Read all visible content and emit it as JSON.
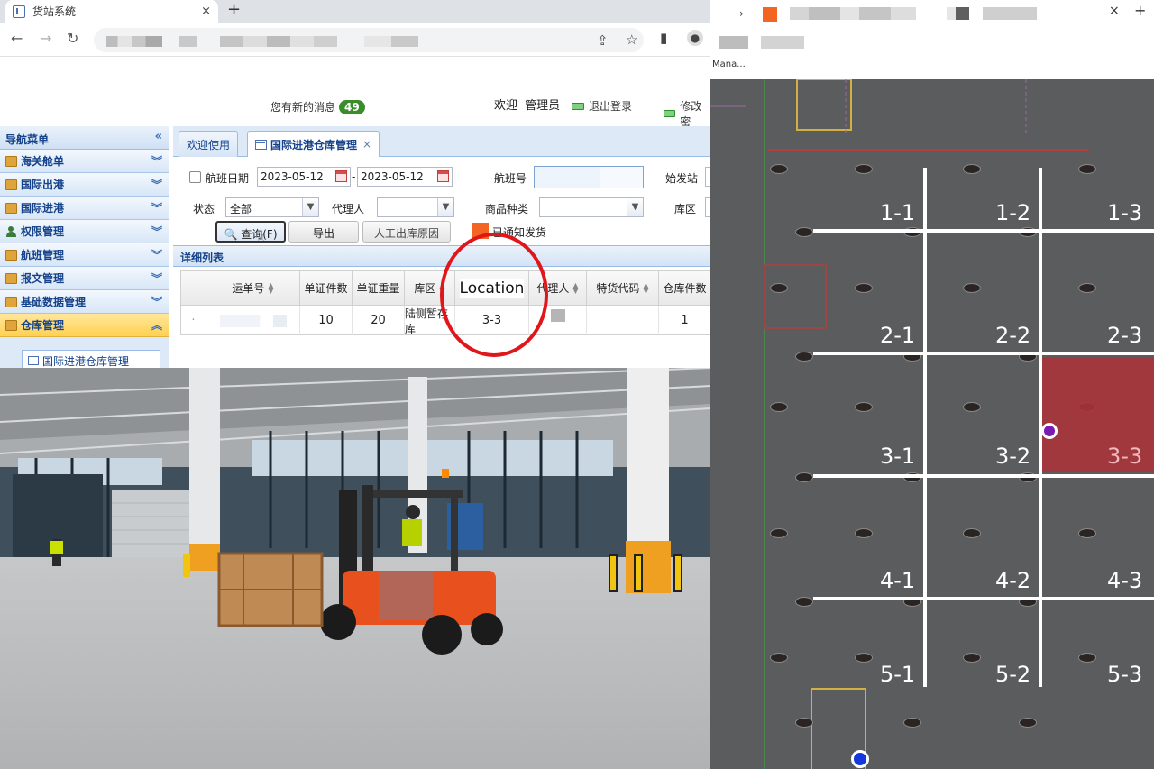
{
  "browser_left": {
    "tab_title": "货站系统",
    "tab_close": "×",
    "new_tab": "+"
  },
  "app": {
    "message_text": "您有新的消息",
    "message_count": "49",
    "welcome": "欢迎",
    "user": "管理员",
    "logout": "退出登录",
    "change_password": "修改密"
  },
  "sidebar": {
    "header": "导航菜单",
    "items": [
      {
        "label": "海关舱单",
        "icon": "folder-icon"
      },
      {
        "label": "国际出港",
        "icon": "folder-icon"
      },
      {
        "label": "国际进港",
        "icon": "folder-icon"
      },
      {
        "label": "权限管理",
        "icon": "user-icon"
      },
      {
        "label": "航班管理",
        "icon": "folder-icon"
      },
      {
        "label": "报文管理",
        "icon": "folder-icon"
      },
      {
        "label": "基础数据管理",
        "icon": "folder-icon"
      },
      {
        "label": "仓库管理",
        "icon": "folder-icon"
      }
    ],
    "sub_item": "国际进港仓库管理"
  },
  "tabs": {
    "welcome": "欢迎使用",
    "active": "国际进港仓库管理",
    "close": "×"
  },
  "filters": {
    "flight_date_label": "航班日期",
    "date_from": "2023-05-12",
    "date_sep": "-",
    "date_to": "2023-05-12",
    "flight_no_label": "航班号",
    "origin_label": "始发站",
    "status_label": "状态",
    "status_value": "全部",
    "agent_label": "代理人",
    "goods_label": "商品种类",
    "zone_label": "库区"
  },
  "actions": {
    "query": "查询(F)",
    "export": "导出",
    "manual_reason": "人工出库原因",
    "legend": "已通知发货",
    "legend_color": "#f26522"
  },
  "grid": {
    "title": "详细列表",
    "columns": [
      "运单号",
      "单证件数",
      "单证重量",
      "库区",
      "Location",
      "代理人",
      "特货代码",
      "仓库件数"
    ],
    "row": {
      "pieces": "10",
      "weight": "20",
      "zone": "陆侧暂存库",
      "location": "3-3",
      "warehouse_pieces": "1"
    }
  },
  "browser_right": {
    "tab_text": "Mana..."
  },
  "map": {
    "highlight_color": "#a8343a",
    "cells": [
      {
        "label": "1-1"
      },
      {
        "label": "1-2"
      },
      {
        "label": "1-3"
      },
      {
        "label": "2-1"
      },
      {
        "label": "2-2"
      },
      {
        "label": "2-3"
      },
      {
        "label": "3-1"
      },
      {
        "label": "3-2"
      },
      {
        "label": "3-3"
      },
      {
        "label": "4-1"
      },
      {
        "label": "4-2"
      },
      {
        "label": "4-3"
      },
      {
        "label": "5-1"
      },
      {
        "label": "5-2"
      },
      {
        "label": "5-3"
      }
    ]
  }
}
